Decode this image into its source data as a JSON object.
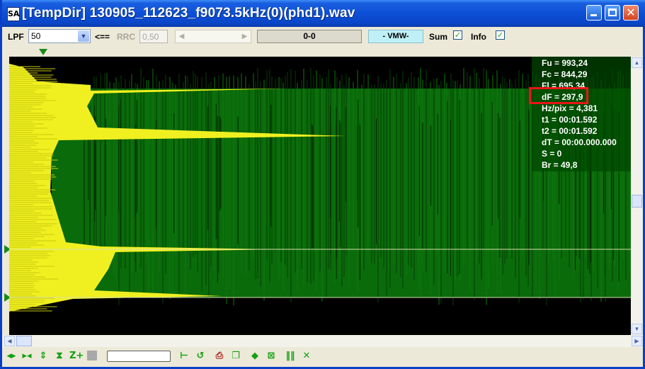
{
  "window": {
    "app_icon": "SA",
    "title": "[TempDir] 130905_112623_f9073.5kHz(0)(phd1).wav",
    "close_glyph": "✕"
  },
  "toolbar": {
    "lpf_label": "LPF",
    "lpf_value": "50",
    "arrow_label": "<==",
    "rrc_label": "RRC",
    "rrc_value": "0,50",
    "counter": "0-0",
    "mode": "- VMW-",
    "sum_label": "Sum",
    "sum_checked": true,
    "info_label": "Info",
    "info_checked": true
  },
  "info_panel": {
    "fu": "Fu = 993,24",
    "fc": "Fc = 844,29",
    "fl": "Fl = 695,34",
    "df": "dF = 297,9",
    "hzpix": "Hz/pix = 4,381",
    "t1": "t1 = 00:01.592",
    "t2": "t2 = 00:01.592",
    "dt": "dT = 00:00.000.000",
    "s": "S = 0",
    "br": "Br = 49,8"
  },
  "colors": {
    "spectrum_green": "#0a6b0a",
    "spectrum_yellow": "#f0f020",
    "background": "#000000",
    "highlight_box": "#e81616"
  },
  "bottom_icons": [
    "nav-left-right-icon",
    "nav-shrink-icon",
    "nav-up-down-icon",
    "zoom-y-icon",
    "zoom-plus-icon",
    "stop-icon",
    "cursor-left-icon",
    "loop-icon",
    "export-icon",
    "copy-icon",
    "diamond-icon",
    "zoom-fit-icon",
    "bars-icon",
    "cross-icon"
  ]
}
